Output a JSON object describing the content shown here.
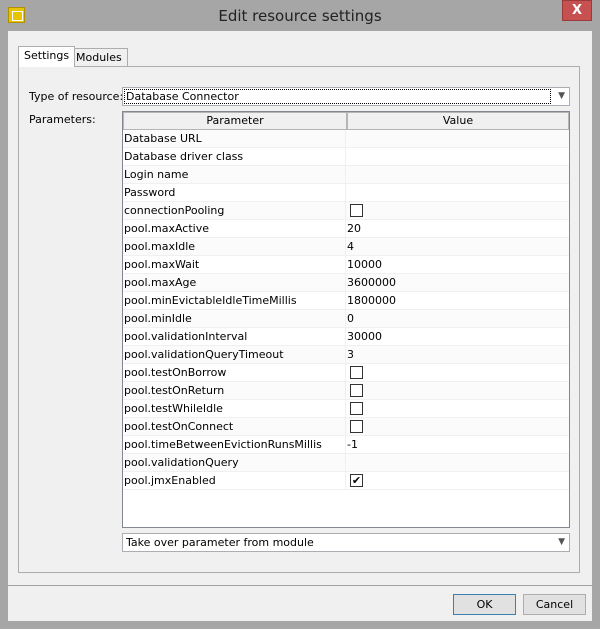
{
  "window": {
    "title": "Edit resource settings",
    "icon": "app-window-icon",
    "close_glyph": "X"
  },
  "tabs": [
    {
      "label": "Settings",
      "active": true
    },
    {
      "label": "Modules",
      "active": false
    }
  ],
  "type_label": "Type of resource:",
  "type_value": "Database Connector",
  "params_label": "Parameters:",
  "table": {
    "headers": [
      "Parameter",
      "Value"
    ],
    "rows": [
      {
        "name": "Database URL",
        "value": ""
      },
      {
        "name": "Database driver class",
        "value": ""
      },
      {
        "name": "Login name",
        "value": ""
      },
      {
        "name": "Password",
        "value": ""
      },
      {
        "name": "connectionPooling",
        "checkbox": false
      },
      {
        "name": "pool.maxActive",
        "value": "20"
      },
      {
        "name": "pool.maxIdle",
        "value": "4"
      },
      {
        "name": "pool.maxWait",
        "value": "10000"
      },
      {
        "name": "pool.maxAge",
        "value": "3600000"
      },
      {
        "name": "pool.minEvictableIdleTimeMillis",
        "value": "1800000"
      },
      {
        "name": "pool.minIdle",
        "value": "0"
      },
      {
        "name": "pool.validationInterval",
        "value": "30000"
      },
      {
        "name": "pool.validationQueryTimeout",
        "value": "3"
      },
      {
        "name": "pool.testOnBorrow",
        "checkbox": false
      },
      {
        "name": "pool.testOnReturn",
        "checkbox": false
      },
      {
        "name": "pool.testWhileIdle",
        "checkbox": false
      },
      {
        "name": "pool.testOnConnect",
        "checkbox": false
      },
      {
        "name": "pool.timeBetweenEvictionRunsMillis",
        "value": "-1"
      },
      {
        "name": "pool.validationQuery",
        "value": ""
      },
      {
        "name": "pool.jmxEnabled",
        "checkbox": true
      }
    ]
  },
  "module_combo": "Take over parameter from module",
  "buttons": {
    "ok": "OK",
    "cancel": "Cancel"
  }
}
